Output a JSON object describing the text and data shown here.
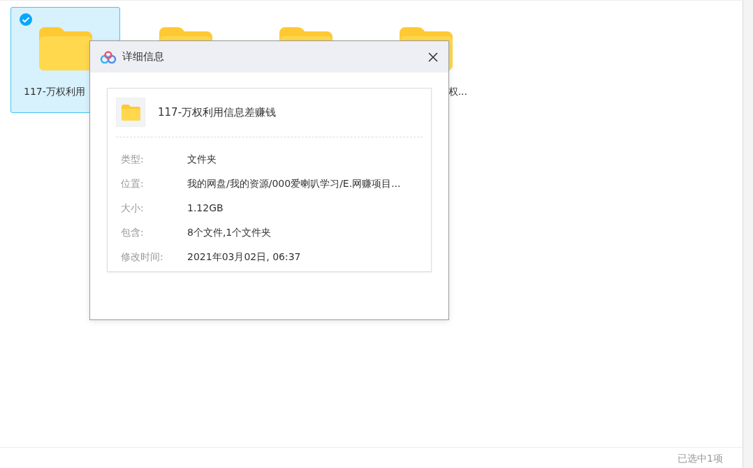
{
  "files": [
    {
      "name": "117-万权利用",
      "selected": true
    },
    {
      "selected": false
    },
    {
      "selected": false
    },
    {
      "name": "权...",
      "selected": false
    }
  ],
  "dialog": {
    "title": "详细信息",
    "file_name": "117-万权利用信息差赚钱",
    "fields": [
      {
        "label": "类型:",
        "value": "文件夹"
      },
      {
        "label": "位置:",
        "value": "我的网盘/我的资源/000爱喇叭学习/E.网赚项目..."
      },
      {
        "label": "大小:",
        "value": "1.12GB"
      },
      {
        "label": "包含:",
        "value": "8个文件,1个文件夹"
      },
      {
        "label": "修改时间:",
        "value": "2021年03月02日, 06:37"
      }
    ]
  },
  "status_bar": {
    "text": "已选中1项"
  }
}
